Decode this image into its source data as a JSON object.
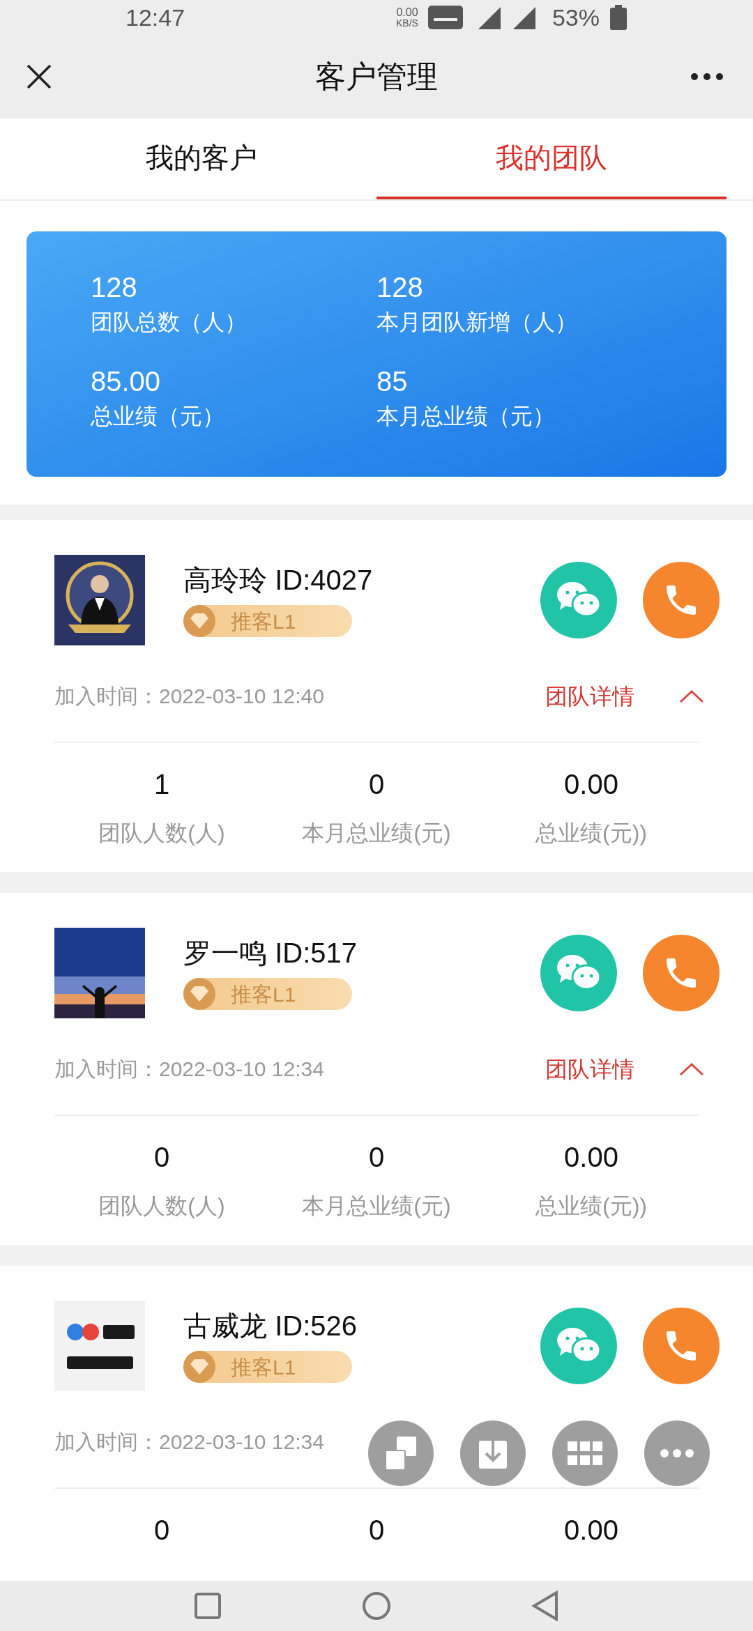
{
  "status_bar": {
    "time": "12:47",
    "net_speed": "0.00",
    "net_unit": "KB/S",
    "battery": "53%"
  },
  "header": {
    "title": "客户管理"
  },
  "tabs": [
    {
      "label": "我的客户",
      "selected": false
    },
    {
      "label": "我的团队",
      "selected": true
    }
  ],
  "summary": [
    {
      "value": "128",
      "label": "团队总数（人）"
    },
    {
      "value": "128",
      "label": "本月团队新增（人）"
    },
    {
      "value": "85.00",
      "label": "总业绩（元）"
    },
    {
      "value": "85",
      "label": "本月总业绩（元）"
    }
  ],
  "members": [
    {
      "avatar": {
        "kind": "picture"
      },
      "name": "高玲玲",
      "id": "ID:4027",
      "badge": "推客L1",
      "join_label": "加入时间：",
      "join_time": "2022-03-10 12:40",
      "detail_link": "团队详情",
      "expanded": true,
      "stats": [
        {
          "value": "1",
          "label": "团队人数(人)"
        },
        {
          "value": "0",
          "label": "本月总业绩(元)"
        },
        {
          "value": "0.00",
          "label": "总业绩(元))"
        }
      ]
    },
    {
      "avatar": {
        "kind": "picture"
      },
      "name": "罗一鸣",
      "id": "ID:517",
      "badge": "推客L1",
      "join_label": "加入时间：",
      "join_time": "2022-03-10 12:34",
      "detail_link": "团队详情",
      "expanded": true,
      "stats": [
        {
          "value": "0",
          "label": "团队人数(人)"
        },
        {
          "value": "0",
          "label": "本月总业绩(元)"
        },
        {
          "value": "0.00",
          "label": "总业绩(元))"
        }
      ]
    },
    {
      "avatar": {
        "kind": "picture"
      },
      "name": "古威龙",
      "id": "ID:526",
      "badge": "推客L1",
      "join_label": "加入时间：",
      "join_time": "2022-03-10 12:34",
      "stats": [
        {
          "value": "0"
        },
        {
          "value": "0"
        },
        {
          "value": "0.00"
        }
      ]
    }
  ]
}
